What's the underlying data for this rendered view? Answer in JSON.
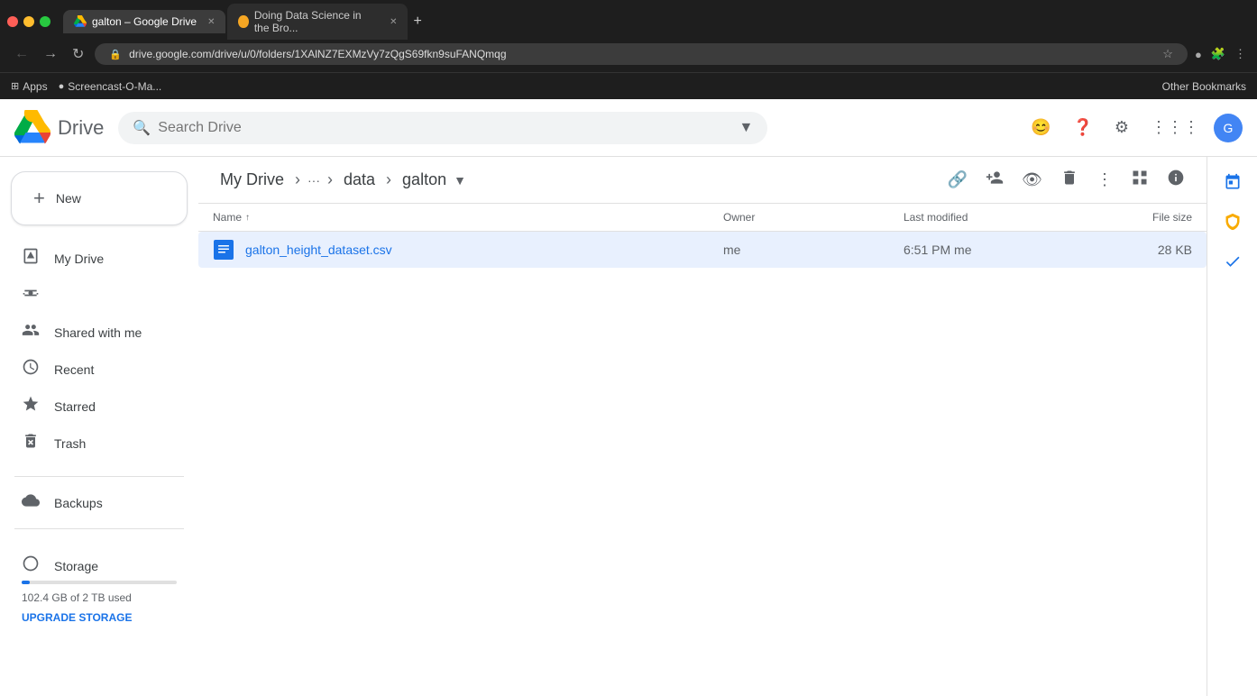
{
  "browser": {
    "tabs": [
      {
        "id": "tab1",
        "label": "galton – Google Drive",
        "favicon_type": "google",
        "active": true
      },
      {
        "id": "tab2",
        "label": "Doing Data Science in the Bro...",
        "favicon_type": "yellow",
        "active": false
      }
    ],
    "url": "drive.google.com/drive/u/0/folders/1XAlNZ7EXMzVy7zQgS69fkn9suFANQmqg",
    "bookmarks": [
      {
        "label": "Apps",
        "icon": "⊞"
      },
      {
        "label": "Screencast-O-Ma...",
        "icon": "●"
      }
    ],
    "bookmarks_right_label": "Other Bookmarks"
  },
  "drive": {
    "logo_text": "Drive",
    "search_placeholder": "Search Drive",
    "header_icons": [
      "feedback",
      "help",
      "settings",
      "apps",
      "avatar"
    ]
  },
  "sidebar": {
    "new_button_label": "New",
    "items": [
      {
        "id": "my-drive",
        "label": "My Drive",
        "icon": "🗂",
        "active": false
      },
      {
        "id": "shared",
        "label": "Shared with me",
        "icon": "👥",
        "active": false
      },
      {
        "id": "recent",
        "label": "Recent",
        "icon": "🕐",
        "active": false
      },
      {
        "id": "starred",
        "label": "Starred",
        "icon": "☆",
        "active": false
      },
      {
        "id": "trash",
        "label": "Trash",
        "icon": "🗑",
        "active": false
      },
      {
        "id": "backups",
        "label": "Backups",
        "icon": "💾",
        "active": false
      },
      {
        "id": "storage",
        "label": "Storage",
        "icon": "☁",
        "active": false
      }
    ],
    "storage": {
      "label": "Storage",
      "used_text": "102.4 GB of 2 TB used",
      "upgrade_label": "UPGRADE STORAGE",
      "fill_percent": 5
    }
  },
  "breadcrumb": {
    "items": [
      {
        "label": "My Drive",
        "id": "my-drive"
      },
      {
        "label": "data",
        "id": "data"
      },
      {
        "label": "galton",
        "id": "galton",
        "current": true
      }
    ],
    "more_label": "···"
  },
  "file_list": {
    "headers": {
      "name": "Name",
      "owner": "Owner",
      "last_modified": "Last modified",
      "file_size": "File size"
    },
    "files": [
      {
        "id": "file1",
        "name": "galton_height_dataset.csv",
        "owner": "me",
        "modified": "6:51 PM  me",
        "size": "28 KB",
        "selected": true
      }
    ]
  },
  "actions": {
    "get_link": "🔗",
    "share": "👤+",
    "preview": "👁",
    "delete": "🗑",
    "more": "⋮",
    "grid_view": "⊞",
    "info": "ⓘ"
  },
  "right_panel_icons": [
    "calendar",
    "tasks",
    "contacts"
  ]
}
